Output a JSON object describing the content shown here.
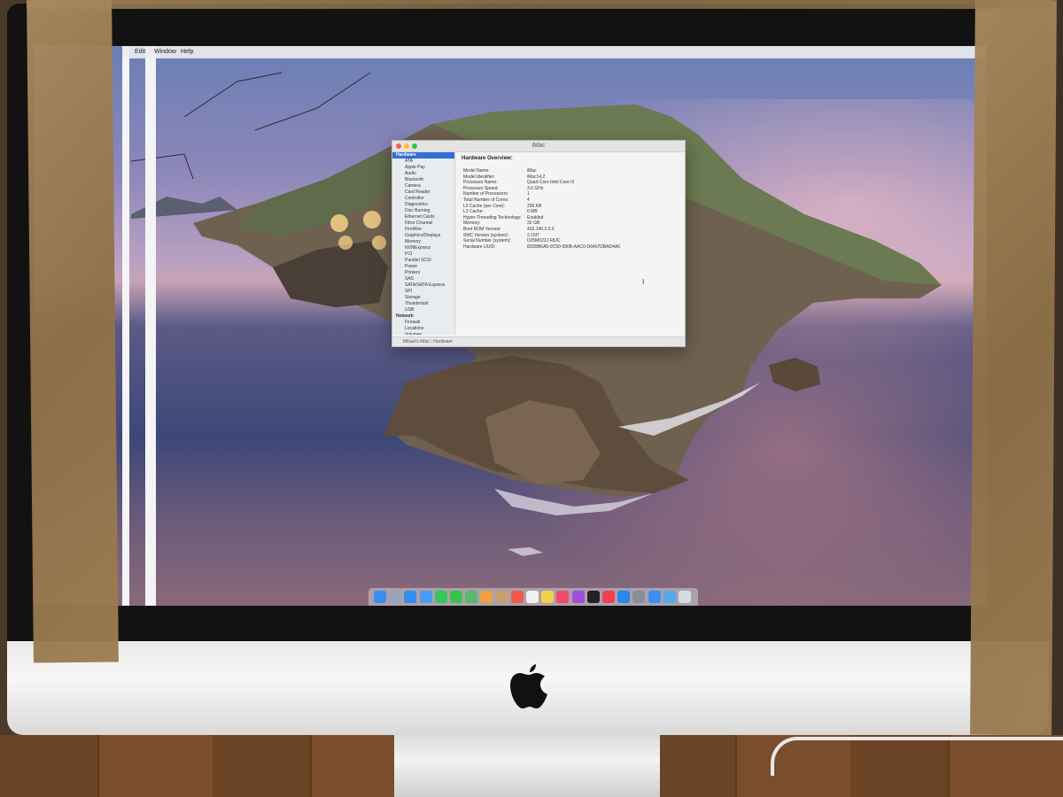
{
  "menubar": {
    "items": [
      "Edit",
      "Window",
      "Help"
    ]
  },
  "window": {
    "title": "iMac",
    "sidebar": [
      {
        "label": "Hardware",
        "kind": "category",
        "selected": true
      },
      {
        "label": "ATA",
        "kind": "item"
      },
      {
        "label": "Apple Pay",
        "kind": "item"
      },
      {
        "label": "Audio",
        "kind": "item"
      },
      {
        "label": "Bluetooth",
        "kind": "item"
      },
      {
        "label": "Camera",
        "kind": "item"
      },
      {
        "label": "Card Reader",
        "kind": "item"
      },
      {
        "label": "Controller",
        "kind": "item"
      },
      {
        "label": "Diagnostics",
        "kind": "item"
      },
      {
        "label": "Disc Burning",
        "kind": "item"
      },
      {
        "label": "Ethernet Cards",
        "kind": "item"
      },
      {
        "label": "Fibre Channel",
        "kind": "item"
      },
      {
        "label": "FireWire",
        "kind": "item"
      },
      {
        "label": "Graphics/Displays",
        "kind": "item"
      },
      {
        "label": "Memory",
        "kind": "item"
      },
      {
        "label": "NVMExpress",
        "kind": "item"
      },
      {
        "label": "PCI",
        "kind": "item"
      },
      {
        "label": "Parallel SCSI",
        "kind": "item"
      },
      {
        "label": "Power",
        "kind": "item"
      },
      {
        "label": "Printers",
        "kind": "item"
      },
      {
        "label": "SAS",
        "kind": "item"
      },
      {
        "label": "SATA/SATA Express",
        "kind": "item"
      },
      {
        "label": "SPI",
        "kind": "item"
      },
      {
        "label": "Storage",
        "kind": "item"
      },
      {
        "label": "Thunderbolt",
        "kind": "item"
      },
      {
        "label": "USB",
        "kind": "item"
      },
      {
        "label": "Network",
        "kind": "category"
      },
      {
        "label": "Firewall",
        "kind": "item"
      },
      {
        "label": "Locations",
        "kind": "item"
      },
      {
        "label": "Volumes",
        "kind": "item"
      }
    ],
    "content_header": "Hardware Overview:",
    "overview": [
      {
        "key": "Model Name:",
        "value": "iMac"
      },
      {
        "key": "Model Identifier:",
        "value": "iMac14,2"
      },
      {
        "key": "Processor Name:",
        "value": "Quad-Core Intel Core i3"
      },
      {
        "key": "Processor Speed:",
        "value": "3.6 GHz"
      },
      {
        "key": "Number of Processors:",
        "value": "1"
      },
      {
        "key": "Total Number of Cores:",
        "value": "4"
      },
      {
        "key": "L2 Cache (per Core):",
        "value": "256 KB"
      },
      {
        "key": "L3 Cache:",
        "value": "6 MB"
      },
      {
        "key": "Hyper-Threading Technology:",
        "value": "Enabled"
      },
      {
        "key": "Memory:",
        "value": "32 GB"
      },
      {
        "key": "Boot ROM Version:",
        "value": "433.140.2.0.0"
      },
      {
        "key": "SMC Version (system):",
        "value": "2.15f7"
      },
      {
        "key": "Serial Number (system):",
        "value": "D25M022J F8JC"
      },
      {
        "key": "Hardware UUID:",
        "value": "82D8B6A5-9C50-590B-AAC0-D6407DBAD4A0"
      }
    ],
    "status_path": "Mikael's iMac › Hardware"
  },
  "dock_icon_names": [
    "finder-icon",
    "launchpad-icon",
    "safari-icon",
    "mail-icon",
    "facetime-icon",
    "messages-icon",
    "maps-icon",
    "photos-icon",
    "contacts-icon",
    "calendar-icon",
    "reminders-icon",
    "notes-icon",
    "music-icon",
    "podcasts-icon",
    "tv-icon",
    "news-icon",
    "app-store-icon",
    "system-preferences-icon",
    "airdrop-icon",
    "documents-icon",
    "trash-icon"
  ],
  "colors": {
    "selection": "#2f6fd8",
    "close": "#ff5f57",
    "minimize": "#febc2e",
    "zoom": "#28c840"
  }
}
